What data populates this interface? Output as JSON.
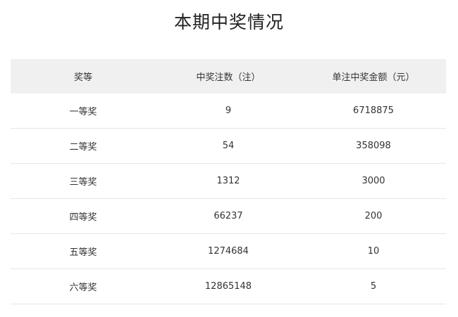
{
  "title": "本期中奖情况",
  "table": {
    "headers": [
      "奖等",
      "中奖注数（注）",
      "单注中奖金额（元）"
    ],
    "rows": [
      {
        "level": "一等奖",
        "count": "9",
        "amount": "6718875"
      },
      {
        "level": "二等奖",
        "count": "54",
        "amount": "358098"
      },
      {
        "level": "三等奖",
        "count": "1312",
        "amount": "3000"
      },
      {
        "level": "四等奖",
        "count": "66237",
        "amount": "200"
      },
      {
        "level": "五等奖",
        "count": "1274684",
        "amount": "10"
      },
      {
        "level": "六等奖",
        "count": "12865148",
        "amount": "5"
      }
    ]
  }
}
